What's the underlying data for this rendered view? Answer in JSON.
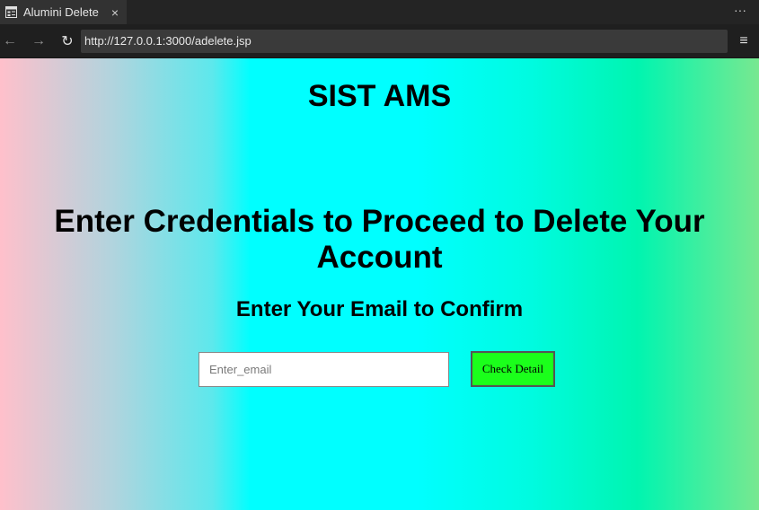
{
  "browser": {
    "tab": {
      "title": "Alumini Delete",
      "close_glyph": "×"
    },
    "more_glyph": "···",
    "nav": {
      "back_glyph": "←",
      "forward_glyph": "→",
      "reload_glyph": "↻",
      "menu_glyph": "≡"
    },
    "url": "http://127.0.0.1:3000/adelete.jsp"
  },
  "page": {
    "site_title": "SIST AMS",
    "heading": "Enter Credentials to Proceed to Delete Your Account",
    "subheading": "Enter Your Email to Confirm",
    "email_input": {
      "value": "",
      "placeholder": "Enter_email"
    },
    "check_button_label": "Check Detail"
  },
  "colors": {
    "button_green": "#1bff1b",
    "gradient_left": "#ffc0cb",
    "gradient_center": "#00ffff",
    "gradient_right": "#78e890"
  },
  "icons": {
    "tab_favicon": "page-icon",
    "close": "close-icon",
    "more": "more-icon",
    "back": "back-arrow-icon",
    "forward": "forward-arrow-icon",
    "reload": "reload-icon",
    "menu": "hamburger-menu-icon"
  }
}
